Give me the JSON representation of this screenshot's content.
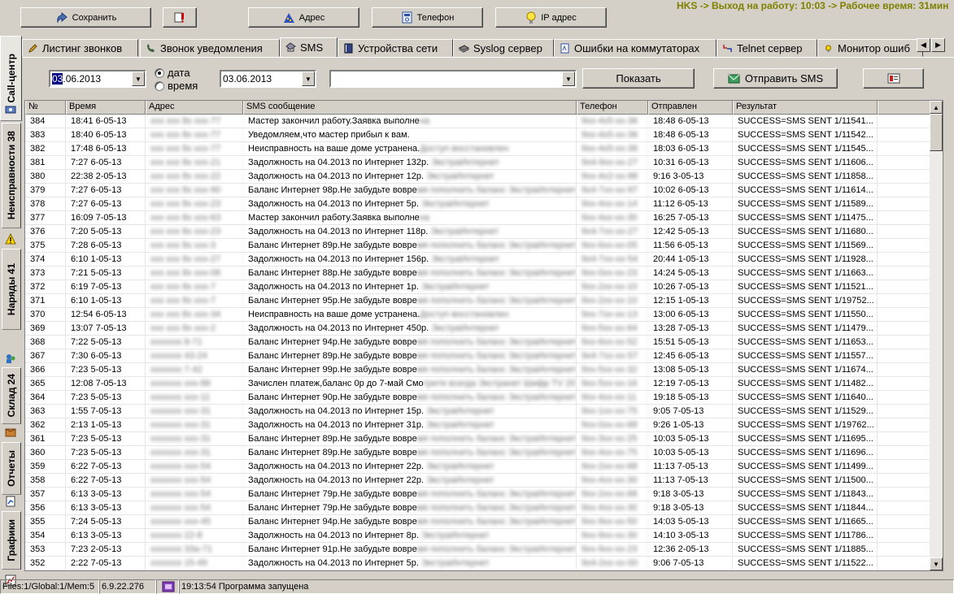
{
  "toolbar": {
    "save_label": "Сохранить",
    "address_label": "Адрес",
    "phone_label": "Телефон",
    "ip_label": "IP адрес"
  },
  "header_status": "HKS -> Выход на работу: 10:03 -> Рабочее время: 31мин",
  "side_tabs": [
    {
      "label": "Call-центр"
    },
    {
      "label": "Неисправности 38"
    },
    {
      "label": "Наряды 41"
    },
    {
      "label": "Склад 24"
    },
    {
      "label": "Отчеты"
    },
    {
      "label": "Графики"
    }
  ],
  "tabs": [
    {
      "label": "Листинг звонков"
    },
    {
      "label": "Звонок уведомления"
    },
    {
      "label": "SMS"
    },
    {
      "label": "Устройства сети"
    },
    {
      "label": "Syslog сервер"
    },
    {
      "label": "Ошибки на коммутаторах"
    },
    {
      "label": "Telnet сервер"
    },
    {
      "label": "Монитор ошиб"
    }
  ],
  "filter": {
    "date_from_sel": "03",
    "date_from_rest": ".06.2013",
    "radio_date": "дата",
    "radio_time": "время",
    "date_to": "03.06.2013",
    "search_value": "",
    "show_label": "Показать",
    "send_label": "Отправить SMS"
  },
  "table": {
    "columns": [
      "№",
      "Время",
      "Адрес",
      "SMS сообщение",
      "Телефон",
      "Отправлен",
      "Результат"
    ],
    "rows": [
      [
        "384",
        "18:41 6-05-13",
        "ххх ххх 8х ххх-77",
        "Мастер закончил работу.Заявка выполнена",
        "9хх-4х5-хх-36",
        "18:48 6-05-13",
        "SUCCESS=SMS SENT 1/11541..."
      ],
      [
        "383",
        "18:40 6-05-13",
        "ххх ххх 8х ххх-77",
        "Уведомляем,что мастер прибыл к вам.",
        "9хх-4х5-хх-36",
        "18:48 6-05-13",
        "SUCCESS=SMS SENT 1/11542..."
      ],
      [
        "382",
        "17:48 6-05-13",
        "ххх ххх 8х ххх-77",
        "Неисправность на ваше доме устранена.Доступ восстановлен",
        "9хх-4х5-хх-36",
        "18:03 6-05-13",
        "SUCCESS=SMS SENT 1/11545..."
      ],
      [
        "381",
        "7:27 6-05-13",
        "ххх ххх 8х ххх-21",
        "Задолжность на 04.2013 по Интернет 132р. ЭкстраИнтернет",
        "9х4-9хх-хх-27",
        "10:31 6-05-13",
        "SUCCESS=SMS SENT 1/11606..."
      ],
      [
        "380",
        "22:38 2-05-13",
        "ххх ххх 8х ххх-22",
        "Задолжность на 04.2013 по Интернет 12р. ЭкстраИнтернет",
        "9хх-4х2-хх-98",
        "9:16 3-05-13",
        "SUCCESS=SMS SENT 1/11858..."
      ],
      [
        "379",
        "7:27 6-05-13",
        "ххх ххх 8х ххх-90",
        "Баланс Интернет 98р.Не забудьте вовремя пополнить баланс ЭкстраИнтернет",
        "9х4-7хх-хх-97",
        "10:02 6-05-13",
        "SUCCESS=SMS SENT 1/11614..."
      ],
      [
        "378",
        "7:27 6-05-13",
        "ххх ххх 8х ххх-23",
        "Задолжность на 04.2013 по Интернет 5р. ЭкстраИнтернет",
        "9хх-4хх-хх-14",
        "11:12 6-05-13",
        "SUCCESS=SMS SENT 1/11589..."
      ],
      [
        "377",
        "16:09 7-05-13",
        "ххх ххх 8х ххх-63",
        "Мастер закончил работу.Заявка выполнена",
        "9хх-4хх-хх-30",
        "16:25 7-05-13",
        "SUCCESS=SMS SENT 1/11475..."
      ],
      [
        "376",
        "7:20 5-05-13",
        "ххх ххх 8х ххх-23",
        "Задолжность на 04.2013 по Интернет 118р. ЭкстраИнтернет",
        "9х4-7хх-хх-27",
        "12:42 5-05-13",
        "SUCCESS=SMS SENT 1/11680..."
      ],
      [
        "375",
        "7:28 6-05-13",
        "ххх ххх 8х ххх-3",
        "Баланс Интернет 89р.Не забудьте вовремя пополнить баланс ЭкстраИнтернет",
        "9хх-6хх-хх-05",
        "11:56 6-05-13",
        "SUCCESS=SMS SENT 1/11569..."
      ],
      [
        "374",
        "6:10 1-05-13",
        "ххх ххх 8х ххх-27",
        "Задолжность на 04.2013 по Интернет 156р. ЭкстраИнтернет",
        "9х4-7хх-хх-54",
        "20:44 1-05-13",
        "SUCCESS=SMS SENT 1/11928..."
      ],
      [
        "373",
        "7:21 5-05-13",
        "ххх ххх 8х ххх-06",
        "Баланс Интернет 88р.Не забудьте вовремя пополнить баланс ЭкстраИнтернет",
        "9хх-0хх-хх-23",
        "14:24 5-05-13",
        "SUCCESS=SMS SENT 1/11663..."
      ],
      [
        "372",
        "6:19 7-05-13",
        "ххх ххх 8х ххх-7",
        "Задолжность на 04.2013 по Интернет 1р. ЭкстраИнтернет",
        "9хх-2хх-хх-10",
        "10:26 7-05-13",
        "SUCCESS=SMS SENT 1/11521..."
      ],
      [
        "371",
        "6:10 1-05-13",
        "ххх ххх 8х ххх-7",
        "Баланс Интернет 95р.Не забудьте вовремя пополнить баланс ЭкстраИнтернет",
        "9хх-2хх-хх-10",
        "12:15 1-05-13",
        "SUCCESS=SMS SENT 1/19752..."
      ],
      [
        "370",
        "12:54 6-05-13",
        "ххх ххх 8х ххх-34",
        "Неисправность на ваше доме устранена.Доступ восстановлен",
        "9хх-7хх-хх-13",
        "13:00 6-05-13",
        "SUCCESS=SMS SENT 1/11550..."
      ],
      [
        "369",
        "13:07 7-05-13",
        "ххх ххх 8х ххх-2",
        "Задолжность на 04.2013 по Интернет 450р. ЭкстраИнтернет",
        "9хх-5хх-хх-64",
        "13:28 7-05-13",
        "SUCCESS=SMS SENT 1/11479..."
      ],
      [
        "368",
        "7:22 5-05-13",
        "ххххххх 8-71",
        "Баланс Интернет 94р.Не забудьте вовремя пополнить баланс ЭкстраИнтернет",
        "9хх-6хх-хх-52",
        "15:51 5-05-13",
        "SUCCESS=SMS SENT 1/11653..."
      ],
      [
        "367",
        "7:30 6-05-13",
        "ххххххх 43-24",
        "Баланс Интернет 89р.Не забудьте вовремя пополнить баланс ЭкстраИнтернет",
        "9х4-7хх-хх-57",
        "12:45 6-05-13",
        "SUCCESS=SMS SENT 1/11557..."
      ],
      [
        "366",
        "7:23 5-05-13",
        "ххххххх 7-42",
        "Баланс Интернет 99р.Не забудьте вовремя пополнить баланс ЭкстраИнтернет",
        "9хх-5хх-хх-32",
        "13:08 5-05-13",
        "SUCCESS=SMS SENT 1/11674..."
      ],
      [
        "365",
        "12:08 7-05-13",
        "ххххххх ххх-86",
        "Зачислен платеж,баланс 0р до 7-май Смотрите всегда Экстранет Шифр TV 20",
        "9хх-5хх-хх-16",
        "12:19 7-05-13",
        "SUCCESS=SMS SENT 1/11482..."
      ],
      [
        "364",
        "7:23 5-05-13",
        "ххххххх ххх-11",
        "Баланс Интернет 90р.Не забудьте вовремя пополнить баланс ЭкстраИнтернет",
        "9хх-4хх-хх-11",
        "19:18 5-05-13",
        "SUCCESS=SMS SENT 1/11640..."
      ],
      [
        "363",
        "1:55 7-05-13",
        "ххххххх ххх-31",
        "Задолжность на 04.2013 по Интернет 15р. ЭкстраИнтернет",
        "9хх-1хх-хх-75",
        "9:05 7-05-13",
        "SUCCESS=SMS SENT 1/11529..."
      ],
      [
        "362",
        "2:13 1-05-13",
        "ххххххх ххх-31",
        "Задолжность на 04.2013 по Интернет 31р. ЭкстраИнтернет",
        "9хх-0хх-хх-68",
        "9:26 1-05-13",
        "SUCCESS=SMS SENT 1/19762..."
      ],
      [
        "361",
        "7:23 5-05-13",
        "ххххххх ххх-31",
        "Баланс Интернет 89р.Не забудьте вовремя пополнить баланс ЭкстраИнтернет",
        "9хх-3хх-хх-25",
        "10:03 5-05-13",
        "SUCCESS=SMS SENT 1/11695..."
      ],
      [
        "360",
        "7:23 5-05-13",
        "ххххххх ххх-31",
        "Баланс Интернет 89р.Не забудьте вовремя пополнить баланс ЭкстраИнтернет",
        "9хх-4хх-хх-75",
        "10:03 5-05-13",
        "SUCCESS=SMS SENT 1/11696..."
      ],
      [
        "359",
        "6:22 7-05-13",
        "ххххххх ххх-54",
        "Задолжность на 04.2013 по Интернет 22р. ЭкстраИнтернет",
        "9хх-2хх-хх-68",
        "11:13 7-05-13",
        "SUCCESS=SMS SENT 1/11499..."
      ],
      [
        "358",
        "6:22 7-05-13",
        "ххххххх ххх-54",
        "Задолжность на 04.2013 по Интернет 22р. ЭкстраИнтернет",
        "9хх-4хх-хх-30",
        "11:13 7-05-13",
        "SUCCESS=SMS SENT 1/11500..."
      ],
      [
        "357",
        "6:13 3-05-13",
        "ххххххх ххх-54",
        "Баланс Интернет 79р.Не забудьте вовремя пополнить баланс ЭкстраИнтернет",
        "9хх-2хх-хх-68",
        "9:18 3-05-13",
        "SUCCESS=SMS SENT 1/11843..."
      ],
      [
        "356",
        "6:13 3-05-13",
        "ххххххх ххх-54",
        "Баланс Интернет 79р.Не забудьте вовремя пополнить баланс ЭкстраИнтернет",
        "9хх-4хх-хх-30",
        "9:18 3-05-13",
        "SUCCESS=SMS SENT 1/11844..."
      ],
      [
        "355",
        "7:24 5-05-13",
        "ххххххх ххх-45",
        "Баланс Интернет 94р.Не забудьте вовремя пополнить баланс ЭкстраИнтернет",
        "9хх-9хх-хх-50",
        "14:03 5-05-13",
        "SUCCESS=SMS SENT 1/11665..."
      ],
      [
        "354",
        "6:13 3-05-13",
        "ххххххх 22-8",
        "Задолжность на 04.2013 по Интернет 8р. ЭкстраИнтернет",
        "9хх-9хх-хх-30",
        "14:10 3-05-13",
        "SUCCESS=SMS SENT 1/11786..."
      ],
      [
        "353",
        "7:23 2-05-13",
        "ххххххх 33а-71",
        "Баланс Интернет 91р.Не забудьте вовремя пополнить баланс ЭкстраИнтернет",
        "9хх-9хх-хх-23",
        "12:36 2-05-13",
        "SUCCESS=SMS SENT 1/11885..."
      ],
      [
        "352",
        "2:22 7-05-13",
        "ххххххх 15-49",
        "Задолжность на 04.2013 по Интернет 5р. ЭкстраИнтернет",
        "9х4-2хх-хх-00",
        "9:06 7-05-13",
        "SUCCESS=SMS SENT 1/11522..."
      ]
    ]
  },
  "statusbar": {
    "files": "Files:1/Global:1/Mem:5",
    "version": "6.9.22.276",
    "message": "19:13:54 Программа запущена"
  },
  "colors": {
    "face": "#d4d0c8",
    "selection": "#000080",
    "status_text": "#808000"
  }
}
